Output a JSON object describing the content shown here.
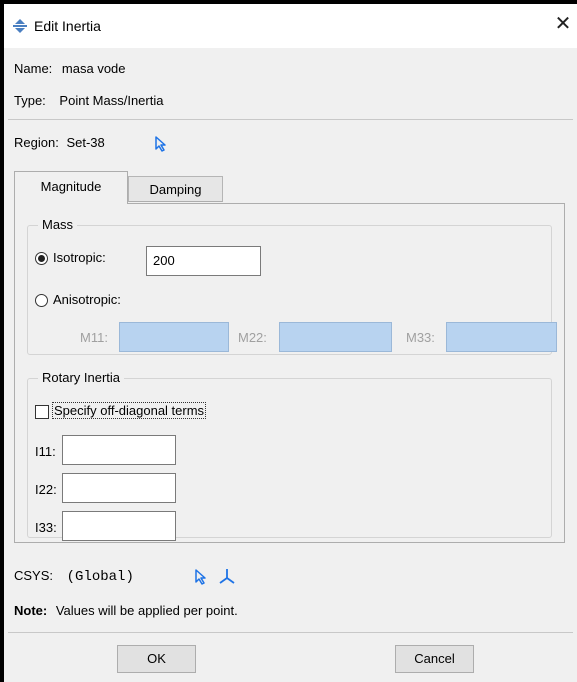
{
  "window": {
    "title": "Edit Inertia",
    "icon": "inertia-app-icon",
    "close_glyph": "✕"
  },
  "info": {
    "name_label": "Name:",
    "name_value": "masa vode",
    "type_label": "Type:",
    "type_value": "Point Mass/Inertia",
    "region_label": "Region:",
    "region_value": "Set-38"
  },
  "tabs": [
    {
      "label": "Magnitude",
      "active": true
    },
    {
      "label": "Damping",
      "active": false
    }
  ],
  "mass": {
    "legend": "Mass",
    "isotropic_label": "Isotropic:",
    "isotropic_value": "200",
    "isotropic_selected": true,
    "anisotropic_label": "Anisotropic:",
    "anisotropic_selected": false,
    "m11_label": "M11:",
    "m22_label": "M22:",
    "m33_label": "M33:"
  },
  "rotary": {
    "legend": "Rotary Inertia",
    "offdiag_label": "Specify off-diagonal terms",
    "offdiag_checked": false,
    "i11_label": "I11:",
    "i22_label": "I22:",
    "i33_label": "I33:"
  },
  "csys": {
    "label": "CSYS:",
    "value": "(Global)"
  },
  "note": {
    "label": "Note:",
    "text": "Values will be applied per point."
  },
  "buttons": {
    "ok": "OK",
    "cancel": "Cancel"
  },
  "colors": {
    "accent_blue": "#1e73e6",
    "disabled_field": "#b8d3f0",
    "dialog_bg": "#f0f0f0"
  }
}
